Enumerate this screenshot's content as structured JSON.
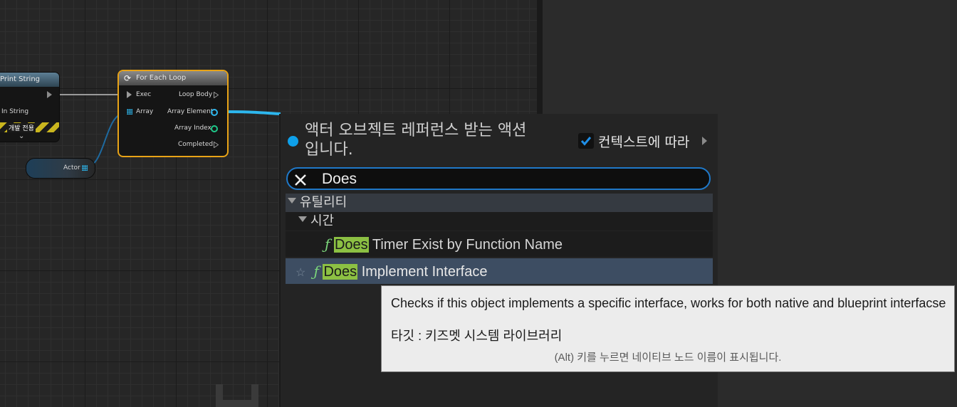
{
  "graph": {
    "print_string_node": {
      "title": "Print String",
      "in_string_label": "In String",
      "dev_only_label": "개발 전용"
    },
    "for_each_node": {
      "title": "For Each Loop",
      "exec_label": "Exec",
      "array_label": "Array",
      "loop_body_label": "Loop Body",
      "array_element_label": "Array Element",
      "array_index_label": "Array Index",
      "completed_label": "Completed"
    },
    "actor_node": {
      "label": "Actor"
    }
  },
  "action_menu": {
    "context_text": "액터 오브젝트 레퍼런스 받는 액션입니다.",
    "context_checkbox_label": "컨텍스트에 따라",
    "context_checkbox_checked": true,
    "search_value": "Does",
    "categories": [
      {
        "label": "유틸리티"
      },
      {
        "label": "시간"
      }
    ],
    "results": [
      {
        "match": "Does",
        "rest": " Timer Exist by Function Name"
      },
      {
        "match": "Does",
        "rest": " Implement Interface",
        "selected": true
      }
    ]
  },
  "tooltip": {
    "description": "Checks if this object implements a specific interface, works for both native and blueprint interfacse",
    "target": "타깃 : 키즈멧 시스템 라이브러리",
    "hint": "(Alt) 키를 누르면 네이티브 노드 이름이 표시됩니다."
  },
  "colors": {
    "highlight": "#8cc043",
    "selected_row": "#3d4d62",
    "search_border": "#1f78c8",
    "object_pin": "#2db7ee",
    "int_pin": "#1ec98a"
  }
}
